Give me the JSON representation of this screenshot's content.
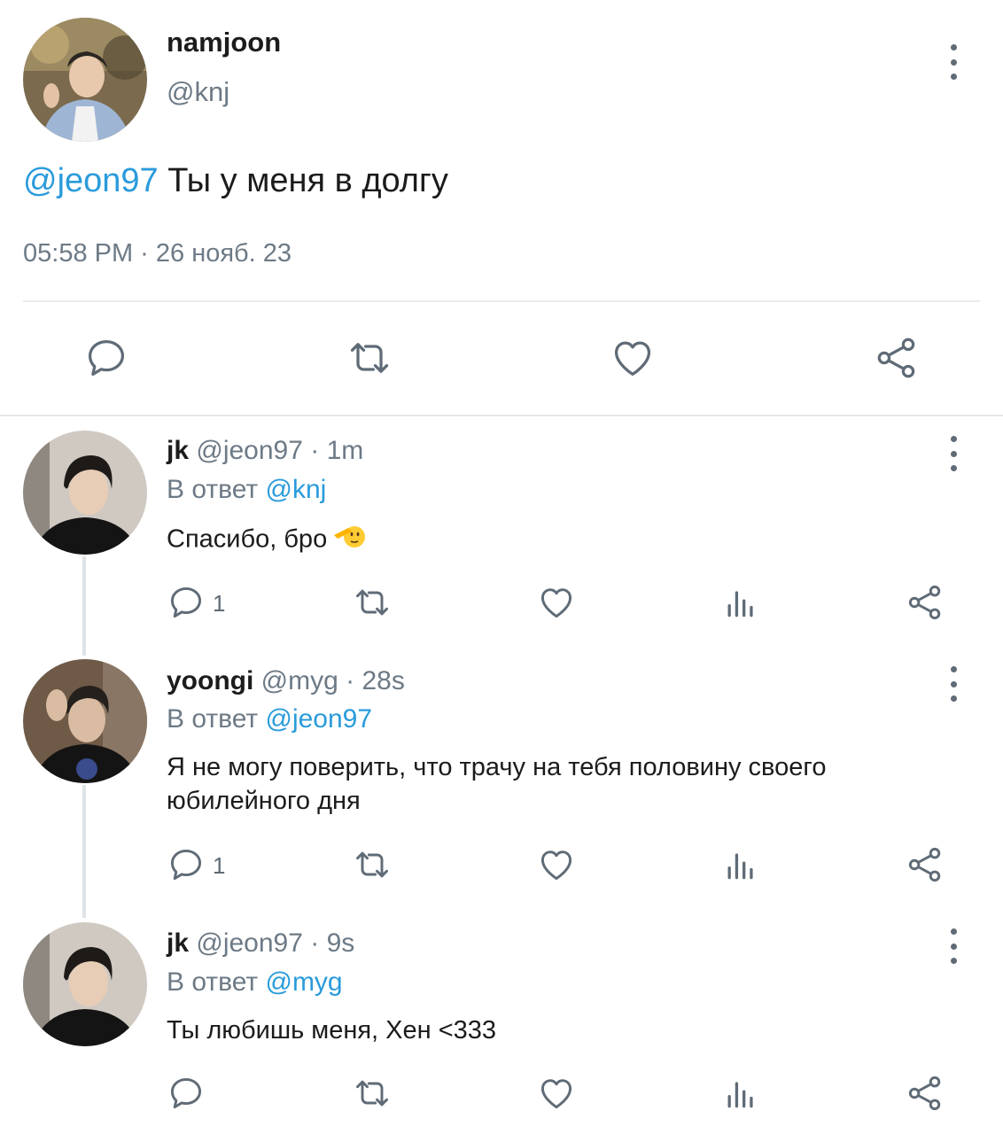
{
  "main_tweet": {
    "name": "namjoon",
    "handle": "@knj",
    "mention": "@jeon97",
    "text": " Ты у меня в долгу",
    "timestamp": "05:58 PM · 26 нояб. 23"
  },
  "replies": [
    {
      "name": "jk",
      "handle": "@jeon97",
      "sep": "·",
      "time": "1m",
      "reply_prefix": "В ответ",
      "reply_to": "@knj",
      "text": "Спасибо, бро",
      "reply_count": "1"
    },
    {
      "name": "yoongi",
      "handle": "@myg",
      "sep": "·",
      "time": "28s",
      "reply_prefix": "В ответ",
      "reply_to": "@jeon97",
      "text": "Я не могу поверить, что трачу на тебя половину своего юбилейного дня",
      "reply_count": "1"
    },
    {
      "name": "jk",
      "handle": "@jeon97",
      "sep": "·",
      "time": "9s",
      "reply_prefix": "В ответ",
      "reply_to": "@myg",
      "text": "Ты любишь меня, Хен <333",
      "reply_count": ""
    }
  ],
  "icons": [
    "more-vertical-icon",
    "comment-icon",
    "retweet-icon",
    "like-icon",
    "share-icon",
    "stats-icon",
    "saluting-face-emoji"
  ],
  "colors": {
    "mention": "#2a9bdb",
    "secondary_text": "#6d7a86",
    "icon": "#5f6b76"
  }
}
